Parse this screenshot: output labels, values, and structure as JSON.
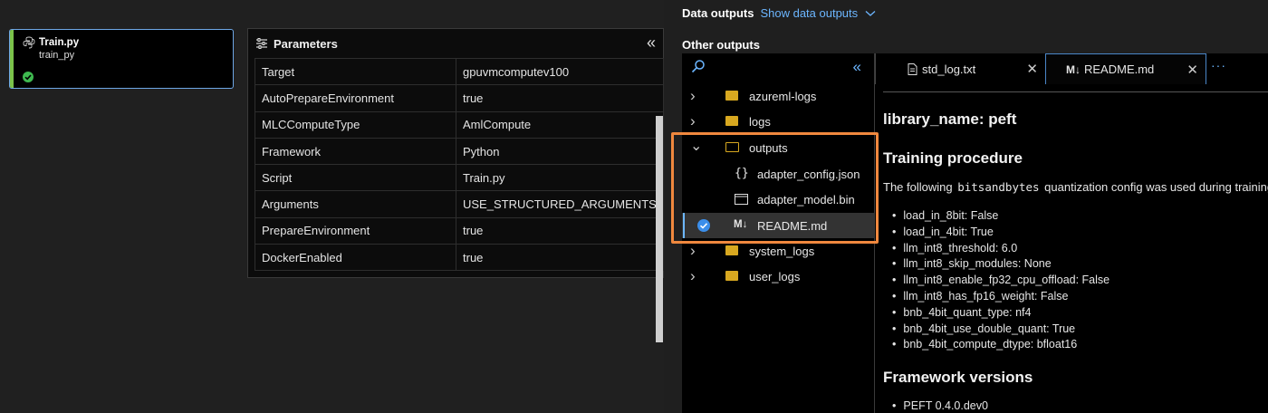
{
  "node": {
    "title": "Train.py",
    "subtitle": "train_py"
  },
  "params": {
    "title": "Parameters",
    "rows": [
      {
        "key": "Target",
        "value": "gpuvmcomputev100"
      },
      {
        "key": "AutoPrepareEnvironment",
        "value": "true"
      },
      {
        "key": "MLCComputeType",
        "value": "AmlCompute"
      },
      {
        "key": "Framework",
        "value": "Python"
      },
      {
        "key": "Script",
        "value": "Train.py"
      },
      {
        "key": "Arguments",
        "value": "USE_STRUCTURED_ARGUMENTS"
      },
      {
        "key": "PrepareEnvironment",
        "value": "true"
      },
      {
        "key": "DockerEnabled",
        "value": "true"
      }
    ]
  },
  "outputs": {
    "data_outputs_label": "Data outputs",
    "show_data_outputs": "Show data outputs",
    "other_outputs_label": "Other outputs",
    "tree": [
      {
        "label": "azureml-logs",
        "type": "folder",
        "expanded": false
      },
      {
        "label": "logs",
        "type": "folder",
        "expanded": false
      },
      {
        "label": "outputs",
        "type": "folder",
        "expanded": true
      },
      {
        "label": "adapter_config.json",
        "type": "json"
      },
      {
        "label": "adapter_model.bin",
        "type": "bin"
      },
      {
        "label": "README.md",
        "type": "md",
        "selected": true
      },
      {
        "label": "system_logs",
        "type": "folder",
        "expanded": false
      },
      {
        "label": "user_logs",
        "type": "folder",
        "expanded": false
      }
    ]
  },
  "tabs": [
    {
      "label": "std_log.txt",
      "icon": "file-icon"
    },
    {
      "label": "README.md",
      "icon": "markdown-icon",
      "active": true
    }
  ],
  "readme": {
    "h_library": "library_name: peft",
    "h_training": "Training procedure",
    "p_pre": "The following",
    "p_code": "bitsandbytes",
    "p_post": "quantization config was used during training:",
    "config": [
      "load_in_8bit: False",
      "load_in_4bit: True",
      "llm_int8_threshold: 6.0",
      "llm_int8_skip_modules: None",
      "llm_int8_enable_fp32_cpu_offload: False",
      "llm_int8_has_fp16_weight: False",
      "bnb_4bit_quant_type: nf4",
      "bnb_4bit_use_double_quant: True",
      "bnb_4bit_compute_dtype: bfloat16"
    ],
    "h_framework": "Framework versions",
    "framework": [
      "PEFT 0.4.0.dev0"
    ]
  }
}
